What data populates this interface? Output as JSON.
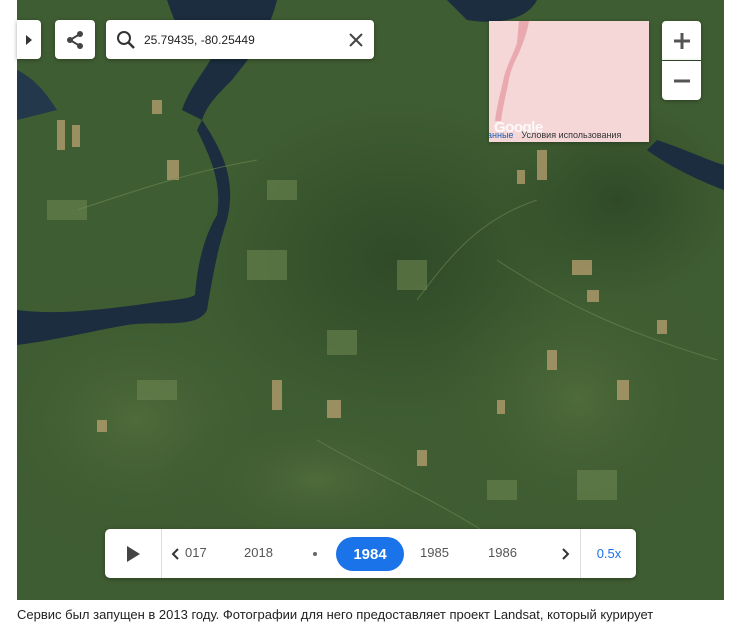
{
  "search": {
    "value": "25.79435, -80.25449"
  },
  "minimap": {
    "logo": "Google",
    "data_label": "анные",
    "terms_label": "Условия использования"
  },
  "timeline": {
    "years": [
      "017",
      "2018",
      "1984",
      "1985",
      "1986"
    ],
    "selected_year": "1984",
    "speed": "0.5x"
  },
  "caption": "Сервис был запущен в 2013 году. Фотографии для него предоставляет проект Landsat, который курирует",
  "colors": {
    "accent": "#1a73e8",
    "forest": "#3c5a30",
    "water": "#1b2d3e"
  },
  "icons": [
    "expand-icon",
    "share-icon",
    "search-icon",
    "close-icon",
    "plus-icon",
    "minus-icon",
    "play-icon",
    "chevron-left-icon",
    "chevron-right-icon"
  ]
}
